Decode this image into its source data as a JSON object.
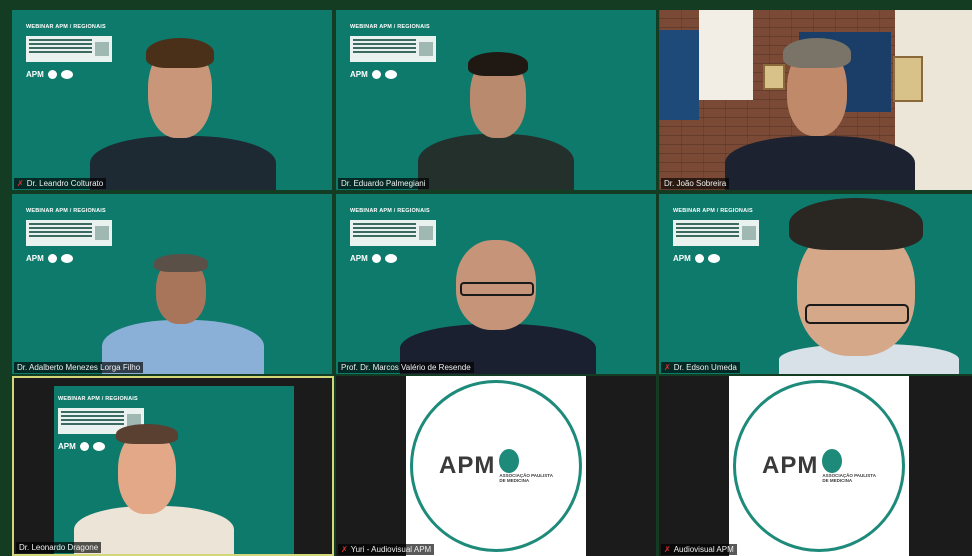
{
  "participants": [
    {
      "name": "Dr. Leandro Colturato",
      "muted": true
    },
    {
      "name": "Dr. Eduardo Palmegiani",
      "muted": false
    },
    {
      "name": "Dr. João Sobreira",
      "muted": false
    },
    {
      "name": "Dr. Adalberto Menezes Lorga Filho",
      "muted": false
    },
    {
      "name": "Prof. Dr. Marcos Valério de Resende",
      "muted": false
    },
    {
      "name": "Dr. Edson Umeda",
      "muted": true
    },
    {
      "name": "Dr. Leonardo Dragone",
      "muted": false
    },
    {
      "name": "Yuri - Audiovisual APM",
      "muted": true
    },
    {
      "name": "Audiovisual APM",
      "muted": true
    }
  ],
  "slide": {
    "title": "WEBINAR APM / REGIONAIS",
    "logo_text": "APM"
  },
  "apm_logo": {
    "text": "APM",
    "subtitle_line1": "ASSOCIAÇÃO PAULISTA",
    "subtitle_line2": "DE MEDICINA"
  },
  "icons": {
    "muted": "mic-off-icon"
  },
  "colors": {
    "tile_green": "#0e7a6c",
    "brand_teal": "#1d8a7a",
    "active_border": "#d4d67a"
  }
}
